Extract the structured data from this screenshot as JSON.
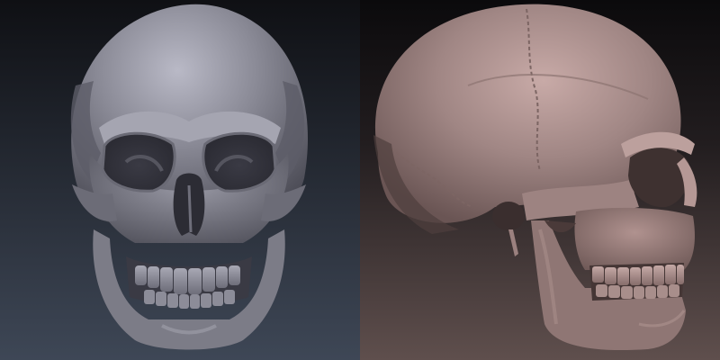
{
  "image": {
    "panels": [
      {
        "view": "front",
        "subject": "skull",
        "material_color": "#7d7d88",
        "background_top": "#111115",
        "background_bottom": "#3c4452"
      },
      {
        "view": "side",
        "subject": "skull",
        "material_color": "#a48a88",
        "background_top": "#0d0c0e",
        "background_bottom": "#5c4d4b"
      }
    ]
  }
}
